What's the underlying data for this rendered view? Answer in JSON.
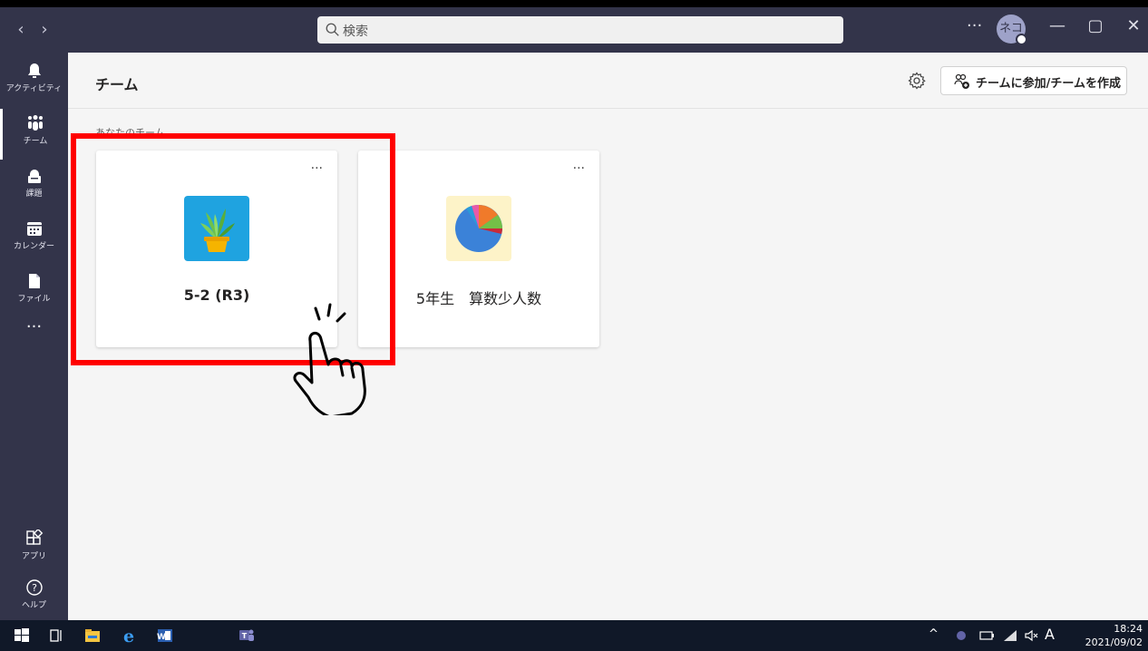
{
  "titlebar": {
    "back_icon": "chevron-left-icon",
    "forward_icon": "chevron-right-icon",
    "search_placeholder": "検索",
    "more": "···",
    "avatar_initials": "ネコ",
    "minimize": "—",
    "maximize": "▢",
    "close": "✕"
  },
  "rail": {
    "items": [
      {
        "label": "アクティビティ",
        "icon": "bell-icon"
      },
      {
        "label": "チーム",
        "icon": "teams-icon"
      },
      {
        "label": "課題",
        "icon": "assignments-icon"
      },
      {
        "label": "カレンダー",
        "icon": "calendar-icon"
      },
      {
        "label": "ファイル",
        "icon": "file-icon"
      }
    ],
    "more": "···",
    "apps_label": "アプリ",
    "help_label": "ヘルプ"
  },
  "main": {
    "title": "チーム",
    "join_button": "チームに参加/チームを作成",
    "section_label": "あなたのチーム",
    "cards": [
      {
        "name": "5-2 (R3)",
        "more": "···",
        "logo": "plant-logo"
      },
      {
        "name": "5年生　算数少人数",
        "more": "···",
        "logo": "pie-chart-logo"
      }
    ]
  },
  "taskbar": {
    "time": "18:24",
    "date": "2021/09/02",
    "ime": "A"
  },
  "colors": {
    "titlebar": "#33344a",
    "highlight": "#ff0000",
    "taskbar": "#101828"
  }
}
